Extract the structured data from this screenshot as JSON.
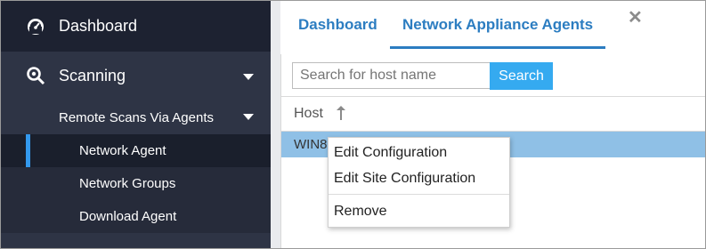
{
  "sidebar": {
    "dashboard_label": "Dashboard",
    "dashboard_icon": "speedometer-icon",
    "scanning_label": "Scanning",
    "scanning_icon": "search-gear-icon",
    "group_label": "Remote Scans Via Agents",
    "items": [
      {
        "label": "Network Agent",
        "active": true
      },
      {
        "label": "Network Groups",
        "active": false
      },
      {
        "label": "Download Agent",
        "active": false
      }
    ]
  },
  "tabs": [
    {
      "label": "Dashboard",
      "active": false
    },
    {
      "label": "Network Appliance Agents",
      "active": true
    }
  ],
  "close_glyph": "✕",
  "search": {
    "placeholder": "Search for host name",
    "value": "",
    "button_label": "Search"
  },
  "table": {
    "column_host": "Host",
    "rows": [
      {
        "host": "WIN8",
        "selected": true
      }
    ]
  },
  "context_menu": {
    "items": [
      "Edit Configuration",
      "Edit Site Configuration",
      "Remove"
    ]
  },
  "colors": {
    "accent": "#2c7dc1",
    "sidebar_bg": "#2e3445",
    "selected_row": "#8fc0e6",
    "search_button": "#35aaf0"
  }
}
